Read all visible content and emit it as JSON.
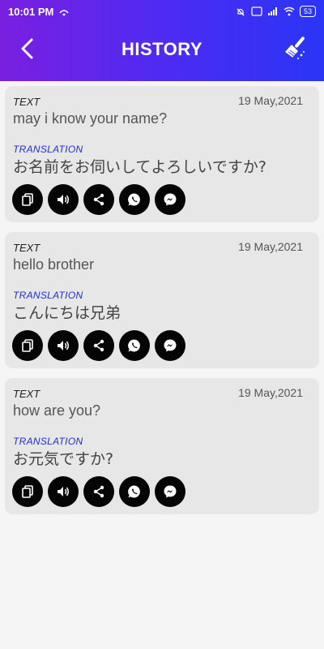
{
  "status_bar": {
    "time": "10:01 PM",
    "battery": "53"
  },
  "header": {
    "title": "HISTORY",
    "back_icon": "chevron-left-icon",
    "clear_icon": "broom-icon"
  },
  "labels": {
    "text": "TEXT",
    "translation": "TRANSLATION"
  },
  "items": [
    {
      "date": "19 May,2021",
      "text": "may i know your name?",
      "translation": "お名前をお伺いしてよろしいですか?"
    },
    {
      "date": "19 May,2021",
      "text": "hello brother",
      "translation": "こんにちは兄弟"
    },
    {
      "date": "19 May,2021",
      "text": "how are you?",
      "translation": "お元気ですか?"
    }
  ],
  "actions": [
    "copy-icon",
    "speaker-icon",
    "share-icon",
    "whatsapp-icon",
    "messenger-icon"
  ],
  "colors": {
    "header_gradient_start": "#7a1fe0",
    "header_gradient_end": "#2a35f5",
    "translation_label": "#1f2fd6",
    "card_bg": "#e7e7e7",
    "action_bg": "#050505"
  }
}
